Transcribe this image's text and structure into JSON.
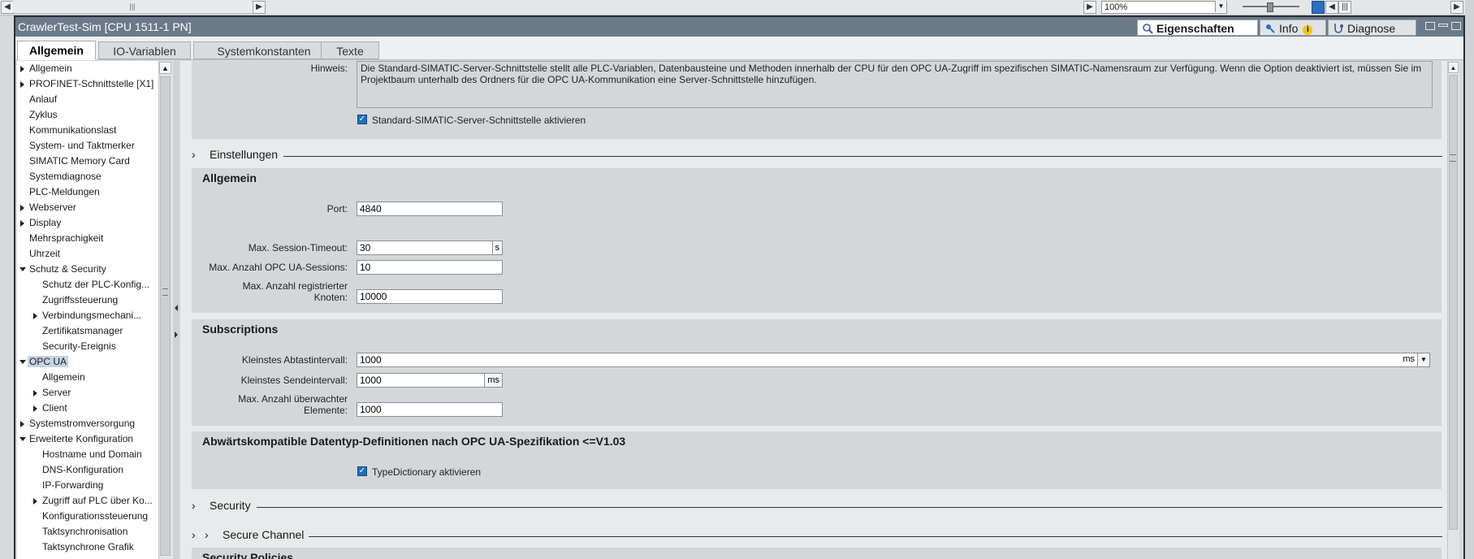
{
  "toolbar": {
    "zoom_value": "100%"
  },
  "window": {
    "title": "CrawlerTest-Sim [CPU 1511-1 PN]",
    "tabs": [
      {
        "label": "Eigenschaften",
        "icon": "properties-icon"
      },
      {
        "label": "Info",
        "icon": "info-icon",
        "badge": "i"
      },
      {
        "label": "Diagnose",
        "icon": "diagnose-icon"
      }
    ]
  },
  "subtabs": [
    "Allgemein",
    "IO-Variablen",
    "Systemkonstanten",
    "Texte"
  ],
  "nav": [
    {
      "label": "Allgemein"
    },
    {
      "label": "PROFINET-Schnittstelle [X1]"
    },
    {
      "label": "Anlauf"
    },
    {
      "label": "Zyklus"
    },
    {
      "label": "Kommunikationslast"
    },
    {
      "label": "System- und Taktmerker"
    },
    {
      "label": "SIMATIC Memory Card"
    },
    {
      "label": "Systemdiagnose"
    },
    {
      "label": "PLC-Meldungen"
    },
    {
      "label": "Webserver"
    },
    {
      "label": "Display"
    },
    {
      "label": "Mehrsprachigkeit"
    },
    {
      "label": "Uhrzeit"
    },
    {
      "label": "Schutz & Security"
    },
    {
      "label": "Schutz der PLC-Konfig..."
    },
    {
      "label": "Zugriffssteuerung"
    },
    {
      "label": "Verbindungsmechani..."
    },
    {
      "label": "Zertifikatsmanager"
    },
    {
      "label": "Security-Ereignis"
    },
    {
      "label": "OPC UA"
    },
    {
      "label": "Allgemein"
    },
    {
      "label": "Server"
    },
    {
      "label": "Client"
    },
    {
      "label": "Systemstromversorgung"
    },
    {
      "label": "Erweiterte Konfiguration"
    },
    {
      "label": "Hostname und Domain"
    },
    {
      "label": "DNS-Konfiguration"
    },
    {
      "label": "IP-Forwarding"
    },
    {
      "label": "Zugriff auf PLC über Ko..."
    },
    {
      "label": "Konfigurationssteuerung"
    },
    {
      "label": "Taktsynchronisation"
    },
    {
      "label": "Taktsynchrone Grafik"
    }
  ],
  "hint": {
    "label": "Hinweis:",
    "text": "Die Standard-SIMATIC-Server-Schnittstelle stellt alle PLC-Variablen, Datenbausteine und Methoden innerhalb der CPU für den OPC UA-Zugriff im spezifischen SIMATIC-Namensraum zur Verfügung. Wenn die Option deaktiviert ist, müssen Sie im Projektbaum unterhalb des Ordners für die OPC UA-Kommunikation eine Server-Schnittstelle hinzufügen.",
    "checkbox_label": "Standard-SIMATIC-Server-Schnittstelle aktivieren",
    "checked": true
  },
  "sections": {
    "einstellungen": "Einstellungen",
    "security": "Security",
    "secure_channel": "Secure Channel",
    "security_policies": "Security Policies"
  },
  "allgemein": {
    "title": "Allgemein",
    "port_label": "Port:",
    "port_value": "4840",
    "session_timeout_label": "Max. Session-Timeout:",
    "session_timeout_value": "30",
    "session_timeout_unit": "s",
    "max_sessions_label": "Max. Anzahl OPC UA-Sessions:",
    "max_sessions_value": "10",
    "max_nodes_label_1": "Max. Anzahl registrierter",
    "max_nodes_label_2": "Knoten:",
    "max_nodes_value": "10000"
  },
  "subscriptions": {
    "title": "Subscriptions",
    "sampling_label": "Kleinstes Abtastintervall:",
    "sampling_value": "1000",
    "sampling_unit": "ms",
    "publish_label": "Kleinstes Sendeintervall:",
    "publish_value": "1000",
    "publish_unit": "ms",
    "monitored_label_1": "Max. Anzahl überwachter",
    "monitored_label_2": "Elemente:",
    "monitored_value": "1000"
  },
  "compat": {
    "title": "Abwärtskompatible Datentyp-Definitionen nach OPC UA-Spezifikation <=V1.03",
    "checkbox_label": "TypeDictionary aktivieren",
    "checked": true
  }
}
